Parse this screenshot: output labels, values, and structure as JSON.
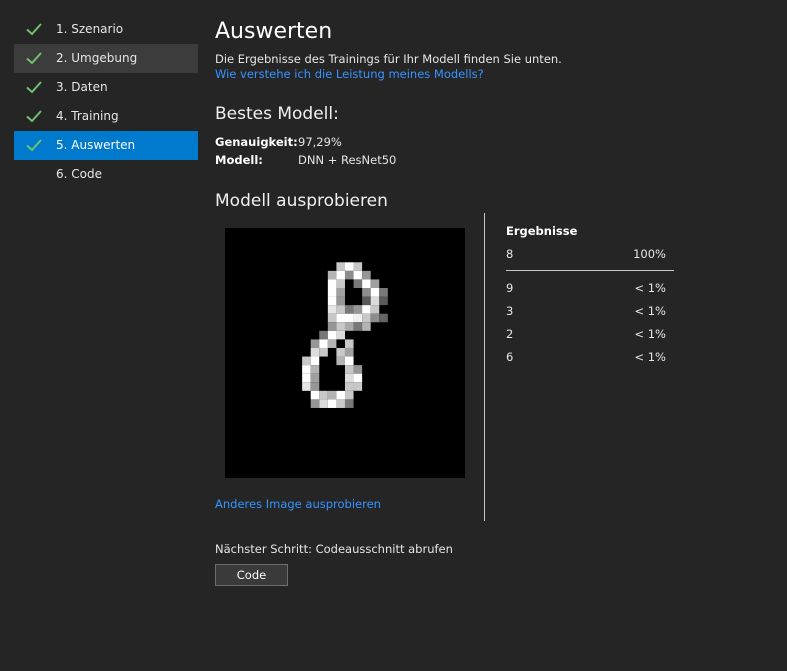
{
  "sidebar": {
    "steps": [
      {
        "label": "1. Szenario",
        "done": true
      },
      {
        "label": "2. Umgebung",
        "done": true
      },
      {
        "label": "3. Daten",
        "done": true
      },
      {
        "label": "4. Training",
        "done": true
      },
      {
        "label": "5. Auswerten",
        "done": true
      },
      {
        "label": "6. Code",
        "done": false
      }
    ],
    "active_step": "5. Auswerten",
    "hovered_step": "2. Umgebung"
  },
  "main": {
    "title": "Auswerten",
    "intro": "Die Ergebnisse des Trainings für Ihr Modell finden Sie unten.",
    "help_link": "Wie verstehe ich die Leistung meines Modells?",
    "best_model": {
      "title": "Bestes Modell:",
      "accuracy_label": "Genauigkeit:",
      "accuracy_value": "97,29%",
      "model_label": "Modell:",
      "model_value": "DNN + ResNet50"
    },
    "try_model": {
      "title": "Modell ausprobieren",
      "image_description_icon": "handwritten-digit-image",
      "other_image_link": "Anderes Image ausprobieren"
    },
    "results": {
      "title": "Ergebnisse",
      "top": {
        "label": "8",
        "value": "100%"
      },
      "others": [
        {
          "label": "9",
          "value": "< 1%"
        },
        {
          "label": "3",
          "value": "< 1%"
        },
        {
          "label": "2",
          "value": "< 1%"
        },
        {
          "label": "6",
          "value": "< 1%"
        }
      ]
    },
    "next_step": "Nächster Schritt: Codeausschnitt abrufen",
    "code_button": "Code"
  },
  "colors": {
    "background": "#252526",
    "accent": "#007acc",
    "link": "#3794ff",
    "check": "#6fc36f"
  }
}
